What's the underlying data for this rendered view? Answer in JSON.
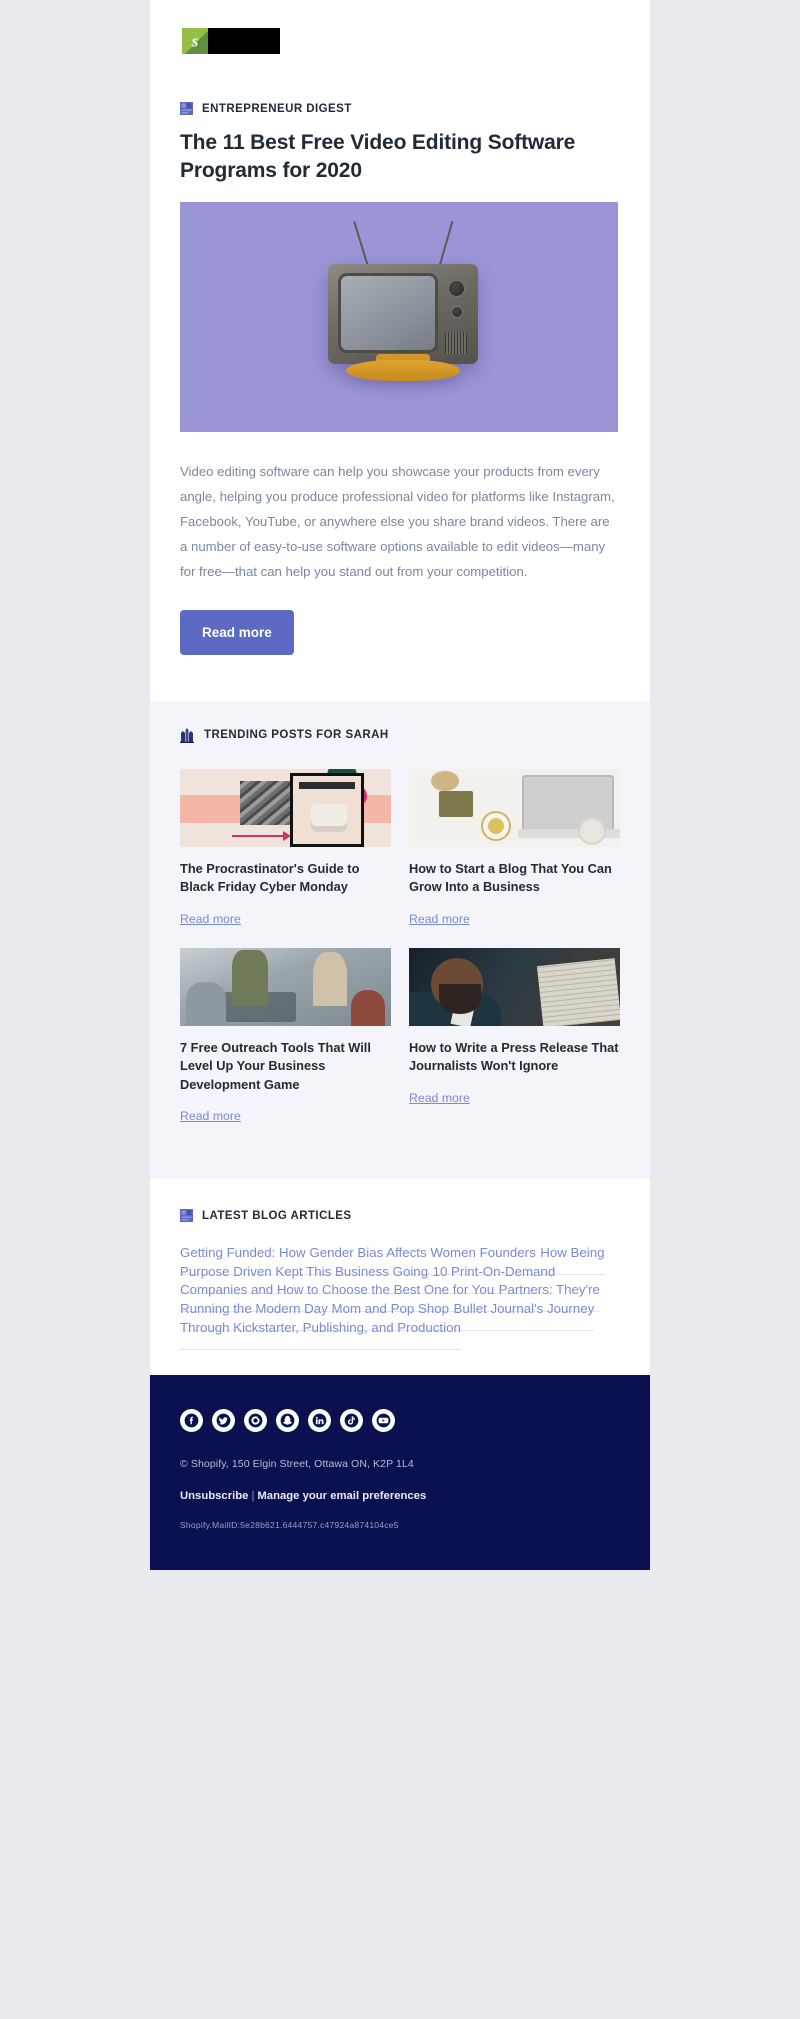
{
  "brand": {
    "logo_alt": "Shopify",
    "logo_green": "#95bf47",
    "accent": "#5c6ac4",
    "footer_bg": "#0b1050"
  },
  "article": {
    "eyebrow": "ENTREPRENEUR DIGEST",
    "title": "The 11 Best Free Video Editing Software Programs for 2020",
    "hero_alt": "Retro television set on purple background",
    "body": "Video editing software can help you showcase your products from every angle, helping you produce professional video for platforms like Instagram, Facebook, YouTube, or anywhere else you share brand videos. There are a number of easy-to-use software options available to edit videos—many for free—that can help you stand out from your competition.",
    "cta_label": "Read more"
  },
  "trending": {
    "heading": "TRENDING POSTS FOR SARAH",
    "read_more_label": "Read more",
    "posts": [
      {
        "title": "The Procrastinator's Guide to Black Friday Cyber Monday",
        "thumb_class": "th1",
        "thumb_alt": "Tablet showing free shipping ad"
      },
      {
        "title": "How to Start a Blog That You Can Grow Into a Business",
        "thumb_class": "th2",
        "thumb_alt": "Desk flatlay with laptop and tea"
      },
      {
        "title": "7 Free Outreach Tools That Will Level Up Your Business Development Game",
        "thumb_class": "th3",
        "thumb_alt": "Team meeting viewed from above"
      },
      {
        "title": "How to Write a Press Release That Journalists Won't Ignore",
        "thumb_class": "th4",
        "thumb_alt": "Man in suit reading a newspaper"
      }
    ]
  },
  "latest": {
    "heading": "LATEST BLOG ARTICLES",
    "items": [
      "Getting Funded: How Gender Bias Affects Women Founders",
      "How Being Purpose Driven Kept This Business Going",
      "10 Print-On-Demand Companies and How to Choose the Best One for You",
      "Partners: They're Running the Modern Day Mom and Pop Shop",
      "Bullet Journal's Journey Through Kickstarter, Publishing, and Production"
    ]
  },
  "footer": {
    "social": [
      {
        "name": "facebook-icon",
        "label": "Facebook"
      },
      {
        "name": "twitter-icon",
        "label": "Twitter"
      },
      {
        "name": "instagram-icon",
        "label": "Instagram"
      },
      {
        "name": "snapchat-icon",
        "label": "Snapchat"
      },
      {
        "name": "linkedin-icon",
        "label": "LinkedIn"
      },
      {
        "name": "tiktok-icon",
        "label": "TikTok"
      },
      {
        "name": "youtube-icon",
        "label": "YouTube"
      }
    ],
    "address": "© Shopify,  150 Elgin Street, Ottawa ON, K2P 1L4",
    "unsubscribe_label": "Unsubscribe",
    "separator": "|",
    "preferences_label": "Manage your email preferences",
    "mail_id": "Shopify.MailID:5e28b621.6444757.c47924a874104ce5"
  }
}
